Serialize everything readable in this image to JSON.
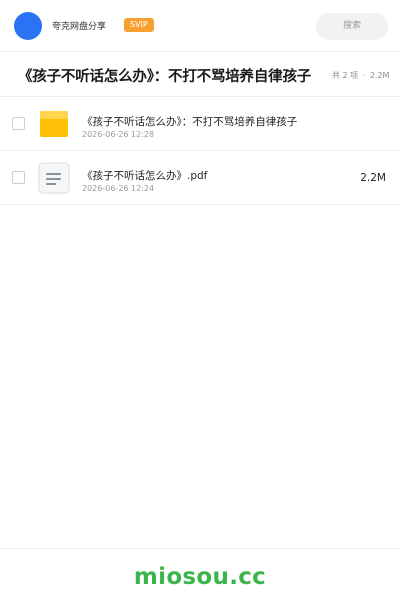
{
  "header": {
    "site_name": "夸克网盘分享",
    "badge": "SVIP",
    "search_placeholder": "搜索",
    "avatar_color": "#2b73f5"
  },
  "title_bar": {
    "title": "《孩子不听话怎么办》：不打不骂培养自律孩子",
    "item_count": "共 2 项",
    "separator": "·",
    "total_size": "2.2M"
  },
  "files": [
    {
      "name": "《孩子不听话怎么办》：不打不骂培养自律孩子",
      "date": "2026-06-26 12:28",
      "size": "",
      "icon": "folder-icon"
    },
    {
      "name": "《孩子不听话怎么办》.pdf",
      "date": "2026-06-26 12:24",
      "size": "2.2M",
      "icon": "document-icon"
    }
  ],
  "footer": {
    "watermark": "miosou.cc"
  },
  "colors": {
    "accent": "#2b73f5",
    "badge": "#f7a032",
    "folder": "#ffc107",
    "watermark": "#3bb54a"
  }
}
